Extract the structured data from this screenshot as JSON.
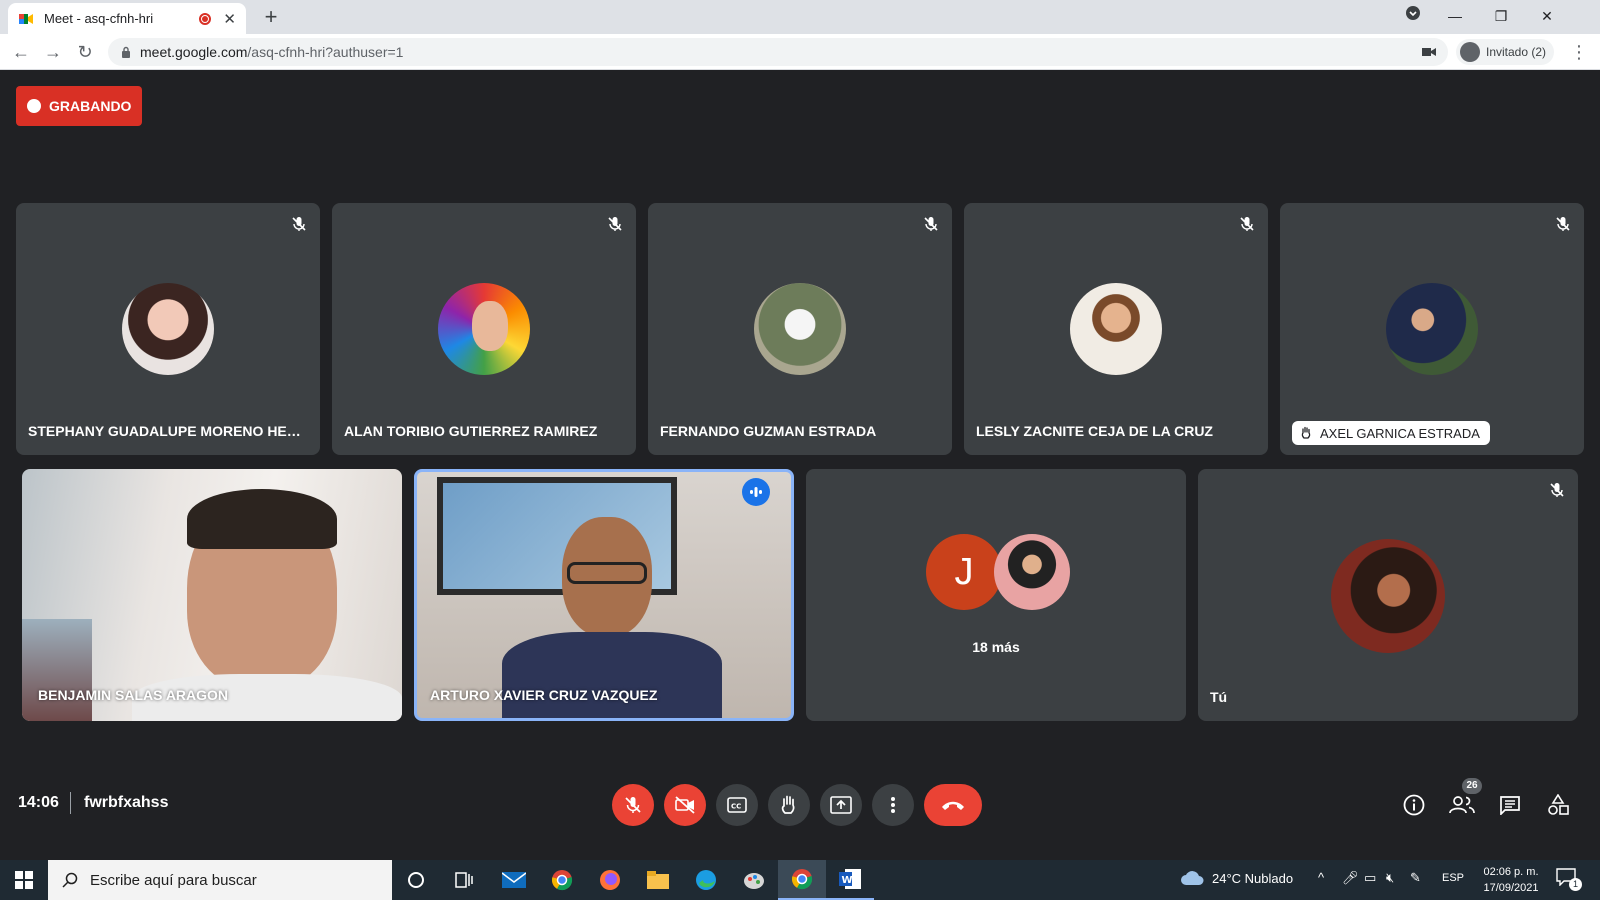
{
  "browser": {
    "tab_title": "Meet - asq-cfnh-hri",
    "url_host": "meet.google.com",
    "url_path": "/asq-cfnh-hri?authuser=1",
    "profile_label": "Invitado (2)"
  },
  "meeting": {
    "recording_label": "GRABANDO",
    "time": "14:06",
    "code": "fwrbfxahss",
    "people_count": "26"
  },
  "participants_row1": [
    {
      "name": "STEPHANY GUADALUPE MORENO HERNANDEZ",
      "muted": true
    },
    {
      "name": "ALAN TORIBIO GUTIERREZ RAMIREZ",
      "muted": true
    },
    {
      "name": "FERNANDO GUZMAN ESTRADA",
      "muted": true
    },
    {
      "name": "LESLY ZACNITE CEJA DE LA CRUZ",
      "muted": true
    },
    {
      "name": "AXEL GARNICA ESTRADA",
      "muted": true,
      "hand_raised": true
    }
  ],
  "participants_row2": [
    {
      "name": "BENJAMIN SALAS ARAGON",
      "video": true
    },
    {
      "name": "ARTURO XAVIER CRUZ VAZQUEZ",
      "video": true,
      "speaking": true
    },
    {
      "name": "18 más",
      "avatar_letter": "J"
    },
    {
      "name": "Tú",
      "muted": true
    }
  ],
  "taskbar": {
    "search_placeholder": "Escribe aquí para buscar",
    "weather": "24°C  Nublado",
    "lang": "ESP",
    "time": "02:06 p. m.",
    "date": "17/09/2021",
    "notifications": "1"
  },
  "colors": {
    "meet_bg": "#202124",
    "tile_bg": "#3c4043",
    "danger": "#ea4335",
    "recording": "#d93025",
    "speaking_border": "#8ab4f8"
  }
}
